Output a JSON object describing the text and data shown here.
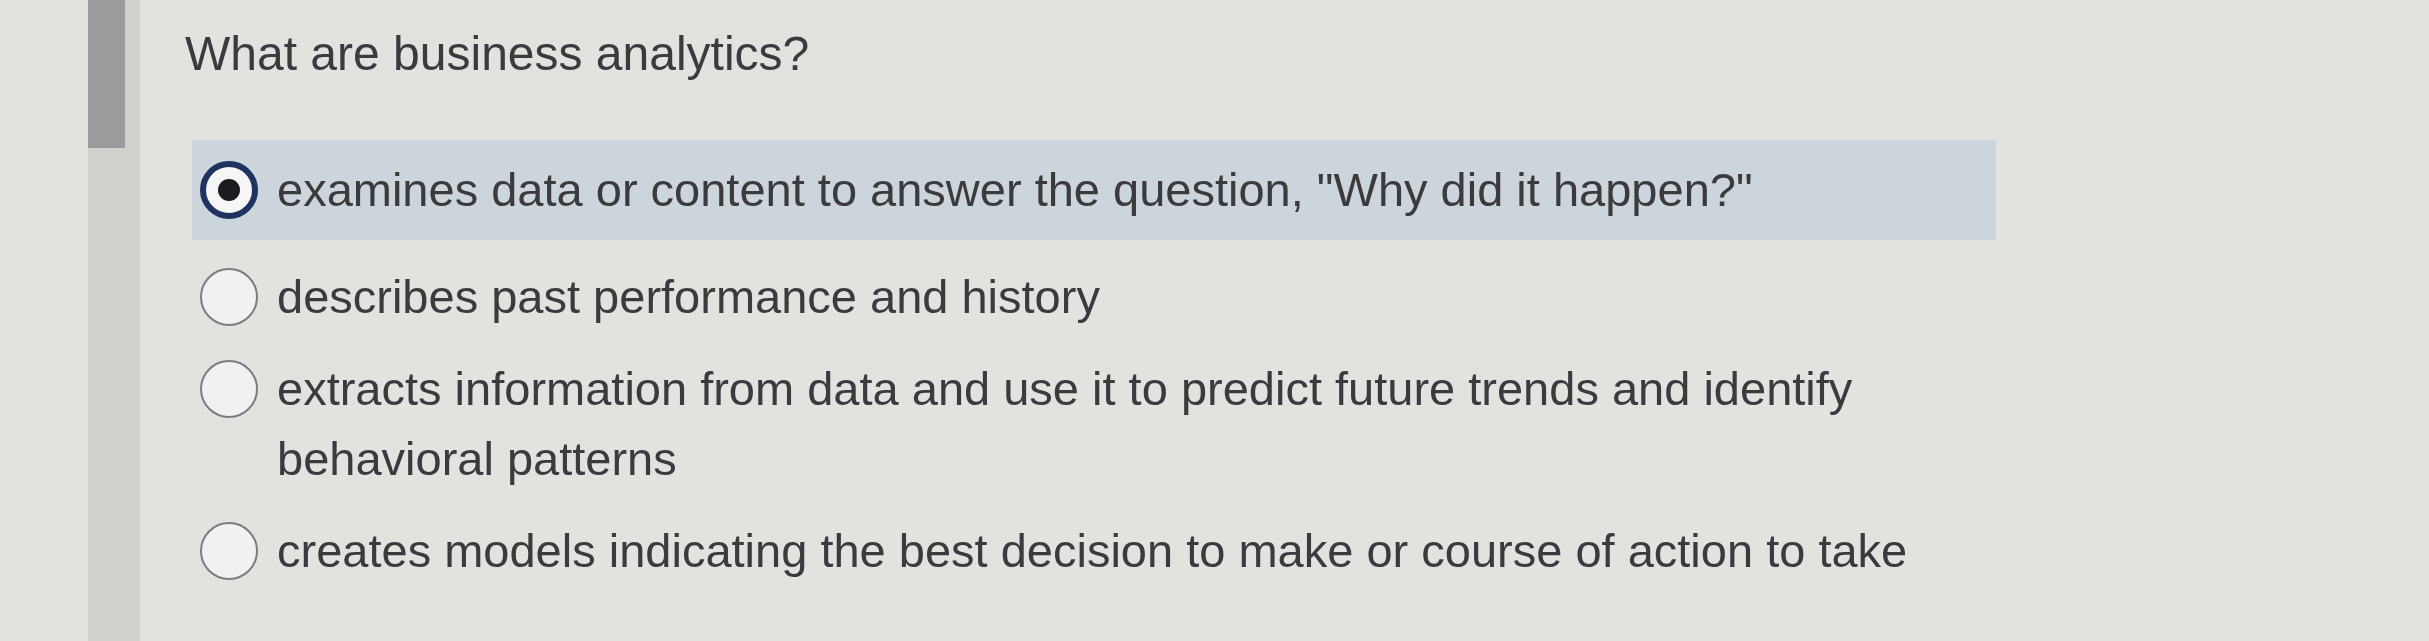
{
  "question": {
    "text": "What are business analytics?"
  },
  "options": [
    {
      "label": "examines data or content to answer the question, \"Why did it happen?\"",
      "selected": true
    },
    {
      "label": "describes past performance and history",
      "selected": false
    },
    {
      "label": "extracts information from data and use it to predict future trends and identify behavioral patterns",
      "selected": false
    },
    {
      "label": "creates models indicating the best decision to make or course of action to take",
      "selected": false
    }
  ]
}
